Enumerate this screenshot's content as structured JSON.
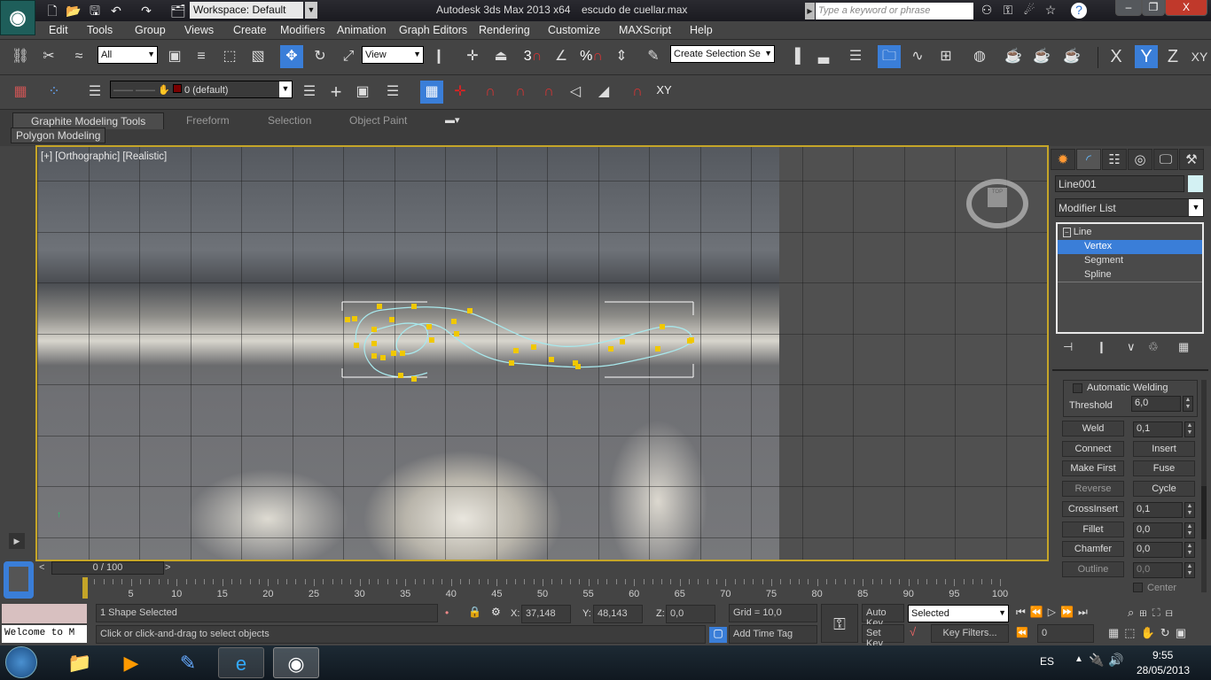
{
  "titlebar": {
    "workspace": "Workspace: Default",
    "app_title": "Autodesk 3ds Max  2013 x64",
    "file_name": "escudo de cuellar.max",
    "search_placeholder": "Type a keyword or phrase"
  },
  "menu": [
    "Edit",
    "Tools",
    "Group",
    "Views",
    "Create",
    "Modifiers",
    "Animation",
    "Graph Editors",
    "Rendering",
    "Customize",
    "MAXScript",
    "Help"
  ],
  "toolbar": {
    "selection_filter": "All",
    "ref_coord": "View",
    "named_selection": "Create Selection Se",
    "snap_angle": "3",
    "snap_percent": "%",
    "axis": [
      "X",
      "Y",
      "Z",
      "XY"
    ],
    "active_axis": "Y"
  },
  "layer_toolbar": {
    "layer": "0 (default)",
    "layer_color": "#7a0000",
    "snap_xy": "XY"
  },
  "ribbon": {
    "tabs": [
      "Graphite Modeling Tools",
      "Freeform",
      "Selection",
      "Object Paint"
    ],
    "active_tab": "Graphite Modeling Tools",
    "panel": "Polygon Modeling"
  },
  "viewport": {
    "label": "[+] [Orthographic] [Realistic]",
    "border_color": "#c5a528",
    "spline_color": "#a8e8ec",
    "vertex_color": "#f0c800",
    "viewcube_label": "TOP"
  },
  "command_panel": {
    "object_name": "Line001",
    "object_color": "#d3f1f3",
    "modifier_list": "Modifier List",
    "stack": [
      {
        "label": "Line",
        "selected": false
      },
      {
        "label": "Vertex",
        "selected": true
      },
      {
        "label": "Segment",
        "selected": false
      },
      {
        "label": "Spline",
        "selected": false
      }
    ],
    "automatic_welding": "Automatic Welding",
    "threshold_label": "Threshold",
    "threshold": "6,0",
    "weld": "Weld",
    "weld_value": "0,1",
    "connect": "Connect",
    "insert": "Insert",
    "make_first": "Make First",
    "fuse": "Fuse",
    "reverse": "Reverse",
    "cycle": "Cycle",
    "crossinsert": "CrossInsert",
    "crossinsert_value": "0,1",
    "fillet": "Fillet",
    "fillet_value": "0,0",
    "chamfer": "Chamfer",
    "chamfer_value": "0,0",
    "outline": "Outline",
    "outline_value": "0,0",
    "center": "Center"
  },
  "timeline": {
    "frame": "0 / 100",
    "ticks": [
      "5",
      "10",
      "15",
      "20",
      "25",
      "30",
      "35",
      "40",
      "45",
      "50",
      "55",
      "60",
      "65",
      "70",
      "75",
      "80",
      "85",
      "90",
      "95",
      "100"
    ]
  },
  "status": {
    "selection": "1 Shape Selected",
    "prompt": "Click or click-and-drag to select objects",
    "maxscript": "Welcome to M",
    "x_label": "X:",
    "x": "37,148",
    "y_label": "Y:",
    "y": "48,143",
    "z_label": "Z:",
    "z": "0,0",
    "grid": "Grid = 10,0",
    "add_time_tag": "Add Time Tag",
    "auto_key": "Auto Key",
    "set_key": "Set Key",
    "key_mode": "Selected",
    "key_filters": "Key Filters...",
    "current_frame": "0"
  },
  "taskbar": {
    "language": "ES",
    "time": "9:55",
    "date": "28/05/2013"
  }
}
